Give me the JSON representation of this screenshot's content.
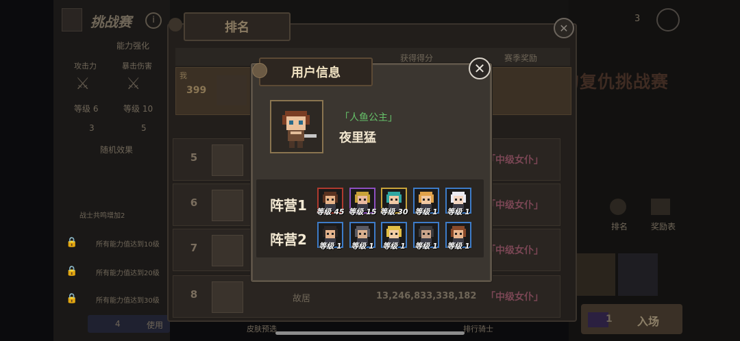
{
  "background": {
    "header_title": "挑战赛",
    "side_panel": {
      "heading": "能力强化",
      "stats": [
        {
          "label": "攻击力",
          "level": "等级 6",
          "count": "3"
        },
        {
          "label": "暴击伤害",
          "level": "等级 10",
          "count": "5"
        }
      ],
      "effects_heading": "随机效果",
      "effect_lines": [
        "战士共鸣增加2",
        "所有能力值达到10级",
        "所有能力值达到20级",
        "所有能力值达到30级"
      ],
      "bottom_count": "4",
      "use_label": "使用"
    },
    "event_title": "的复仇挑战赛",
    "entry_label": "入场",
    "entry_count": "1",
    "right_menu": [
      "排名",
      "奖励表"
    ],
    "top_count": "3"
  },
  "ranking": {
    "tab_label": "排名",
    "columns": [
      "获得得分",
      "赛季奖励"
    ],
    "me": {
      "label": "我",
      "score": "399"
    },
    "rows": [
      {
        "rank": "5",
        "guild": "",
        "score": "",
        "reward": "「中级女仆」"
      },
      {
        "rank": "6",
        "guild": "",
        "score": "",
        "reward": "「中级女仆」"
      },
      {
        "rank": "7",
        "guild": "",
        "score": "",
        "reward": "「中级女仆」"
      },
      {
        "rank": "8",
        "guild": "故居",
        "score": "13,246,833,338,182",
        "reward": "「中级女仆」"
      }
    ],
    "bottom_tabs": [
      "皮肤预选",
      "排行骑士"
    ]
  },
  "modal": {
    "tab_label": "用户信息",
    "close_icon": "close-x-icon",
    "title_badge": "「人鱼公主」",
    "username": "夜里猛",
    "teams": [
      {
        "label": "阵营1",
        "heroes": [
          {
            "level": "等级 45",
            "frame": "#b03a2e",
            "skin": "#e7b48a",
            "hair": "#5a3220"
          },
          {
            "level": "等级 15",
            "frame": "#8e4fc2",
            "skin": "#e8b9a0",
            "hair": "#c9a238"
          },
          {
            "level": "等级 30",
            "frame": "#c9a43a",
            "skin": "#f0c9a6",
            "hair": "#2fa7a2"
          },
          {
            "level": "等级 1",
            "frame": "#3d7cc9",
            "skin": "#f1c8a2",
            "hair": "#e0a24a"
          },
          {
            "level": "等级 1",
            "frame": "#3d7cc9",
            "skin": "#f3d6c2",
            "hair": "#eaeaf2"
          }
        ]
      },
      {
        "label": "阵营2",
        "heroes": [
          {
            "level": "等级 1",
            "frame": "#3d7cc9",
            "skin": "#e4b38d",
            "hair": "#2b2524"
          },
          {
            "level": "等级 1",
            "frame": "#3d7cc9",
            "skin": "#d9b08f",
            "hair": "#5b5b63"
          },
          {
            "level": "等级 1",
            "frame": "#3d7cc9",
            "skin": "#f2cda4",
            "hair": "#e2bf45"
          },
          {
            "level": "等级 1",
            "frame": "#3d7cc9",
            "skin": "#caa48a",
            "hair": "#3b3a3d"
          },
          {
            "level": "等级 1",
            "frame": "#3d7cc9",
            "skin": "#eab78f",
            "hair": "#8a4a2a"
          }
        ]
      }
    ]
  }
}
